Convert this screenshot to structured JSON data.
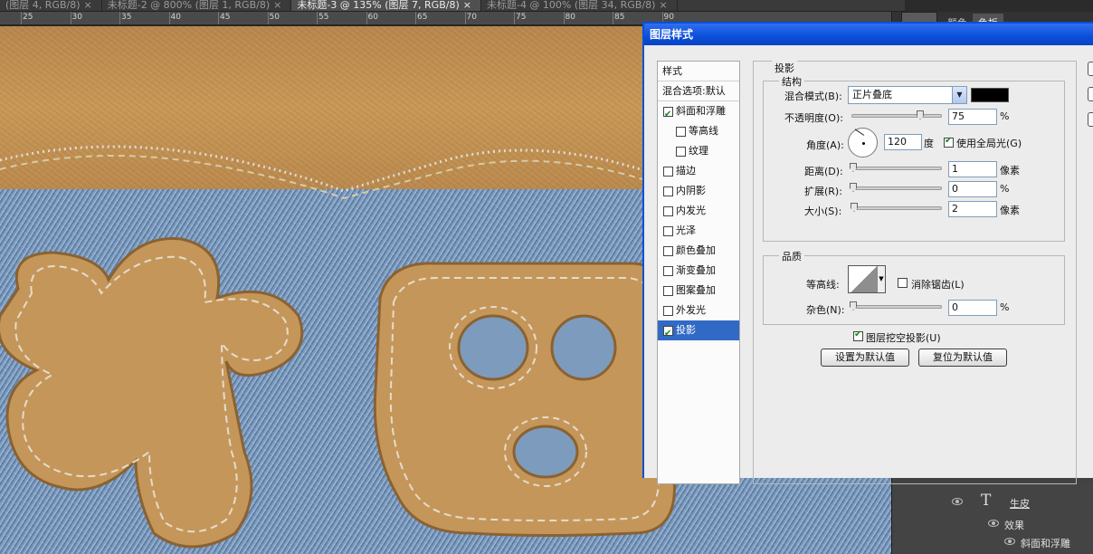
{
  "document_tabs": [
    {
      "label": "(图层 4, RGB/8)",
      "close": "×",
      "active": false
    },
    {
      "label": "未标题-2 @ 800% (图层 1, RGB/8)",
      "close": "×",
      "active": false
    },
    {
      "label": "未标题-3 @ 135% (图层 7, RGB/8)",
      "close": "×",
      "active": true
    },
    {
      "label": "未标题-4 @ 100% (图层 34, RGB/8)",
      "close": "×",
      "active": false
    }
  ],
  "ruler": {
    "labels": [
      "25",
      "30",
      "35",
      "40",
      "45",
      "50",
      "55",
      "60",
      "65",
      "70",
      "75",
      "80",
      "85",
      "90"
    ]
  },
  "right_panel": {
    "tabs": [
      "颜色",
      "色板"
    ],
    "active_tab": "色板"
  },
  "layers_panel": {
    "layer_name": "生皮",
    "effects_label": "效果",
    "effect_item": "斜面和浮雕",
    "layer_type_icon": "text-layer-icon"
  },
  "dialog": {
    "title": "图层样式",
    "style_list_header": "样式",
    "blending_options": "混合选项:默认",
    "items": [
      {
        "label": "斜面和浮雕",
        "checked": true,
        "indent": false,
        "selected": false
      },
      {
        "label": "等高线",
        "checked": false,
        "indent": true,
        "selected": false
      },
      {
        "label": "纹理",
        "checked": false,
        "indent": true,
        "selected": false
      },
      {
        "label": "描边",
        "checked": false,
        "indent": false,
        "selected": false
      },
      {
        "label": "内阴影",
        "checked": false,
        "indent": false,
        "selected": false
      },
      {
        "label": "内发光",
        "checked": false,
        "indent": false,
        "selected": false
      },
      {
        "label": "光泽",
        "checked": false,
        "indent": false,
        "selected": false
      },
      {
        "label": "颜色叠加",
        "checked": false,
        "indent": false,
        "selected": false
      },
      {
        "label": "渐变叠加",
        "checked": false,
        "indent": false,
        "selected": false
      },
      {
        "label": "图案叠加",
        "checked": false,
        "indent": false,
        "selected": false
      },
      {
        "label": "外发光",
        "checked": false,
        "indent": false,
        "selected": false
      },
      {
        "label": "投影",
        "checked": true,
        "indent": false,
        "selected": true
      }
    ],
    "section_title": "投影",
    "structure": {
      "title": "结构",
      "blend_mode_label": "混合模式(B):",
      "blend_mode_value": "正片叠底",
      "shadow_color": "#000000",
      "opacity_label": "不透明度(O):",
      "opacity_value": "75",
      "opacity_fraction": 0.75,
      "percent": "%",
      "angle_label": "角度(A):",
      "angle_value": "120",
      "angle_unit": "度",
      "global_light_label": "使用全局光(G)",
      "global_light_checked": true,
      "distance_label": "距离(D):",
      "distance_value": "1",
      "distance_unit": "像素",
      "spread_label": "扩展(R):",
      "spread_value": "0",
      "spread_unit": "%",
      "size_label": "大小(S):",
      "size_value": "2",
      "size_unit": "像素"
    },
    "quality": {
      "title": "品质",
      "contour_label": "等高线:",
      "antialias_label": "消除锯齿(L)",
      "antialias_checked": false,
      "noise_label": "杂色(N):",
      "noise_value": "0",
      "noise_unit": "%"
    },
    "knockout_label": "图层挖空投影(U)",
    "knockout_checked": true,
    "make_default_button": "设置为默认值",
    "reset_default_button": "复位为默认值"
  }
}
